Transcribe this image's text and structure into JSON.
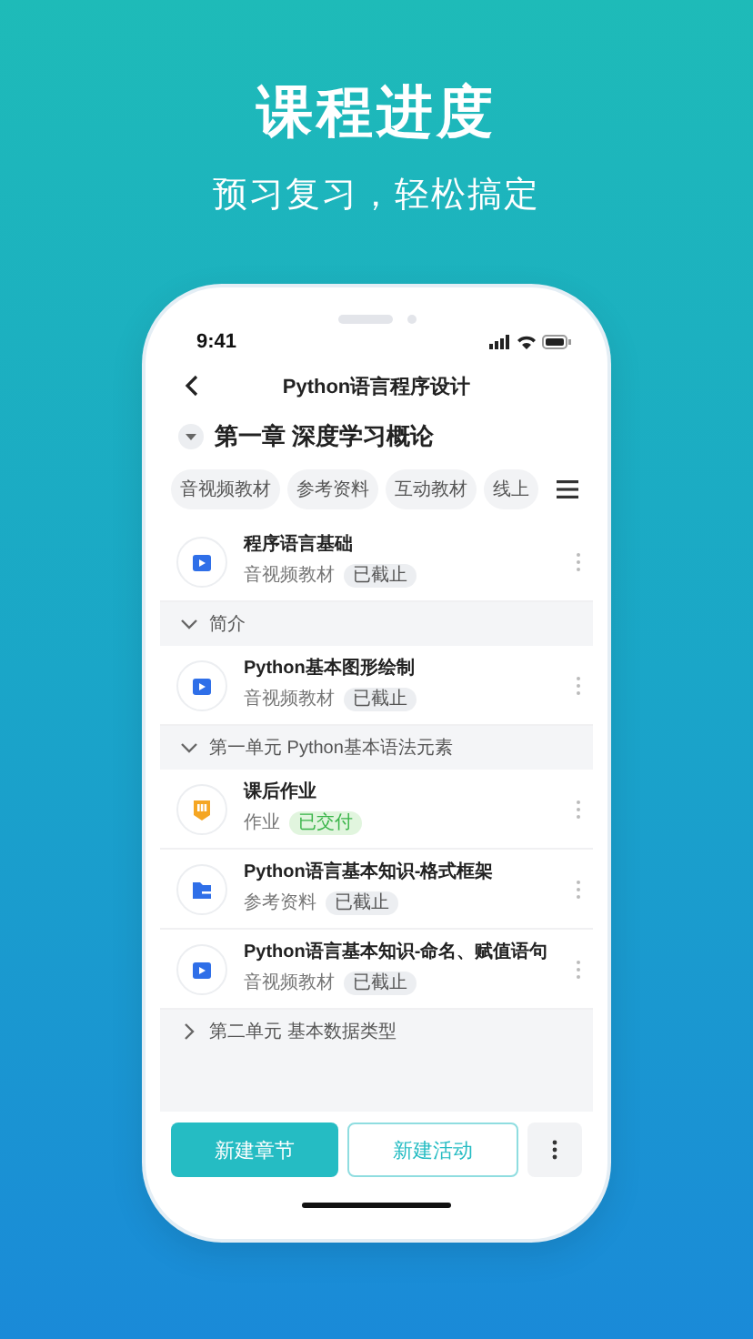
{
  "header": {
    "title": "课程进度",
    "subtitle": "预习复习，轻松搞定"
  },
  "status_bar": {
    "time": "9:41"
  },
  "nav": {
    "title": "Python语言程序设计"
  },
  "chapter": {
    "title": "第一章 深度学习概论",
    "expanded": true
  },
  "filters": [
    {
      "label": "音视频教材"
    },
    {
      "label": "参考资料"
    },
    {
      "label": "互动教材"
    },
    {
      "label": "线上"
    }
  ],
  "list": [
    {
      "kind": "video",
      "title": "程序语言基础",
      "type": "音视频教材",
      "status": {
        "text": "已截止",
        "kind": "closed"
      }
    },
    {
      "kind": "section",
      "title": "简介",
      "expanded": true
    },
    {
      "kind": "video",
      "title": "Python基本图形绘制",
      "type": "音视频教材",
      "status": {
        "text": "已截止",
        "kind": "closed"
      }
    },
    {
      "kind": "section",
      "title": "第一单元 Python基本语法元素",
      "expanded": true
    },
    {
      "kind": "homework",
      "title": "课后作业",
      "type": "作业",
      "status": {
        "text": "已交付",
        "kind": "submitted"
      }
    },
    {
      "kind": "folder",
      "title": "Python语言基本知识-格式框架",
      "type": "参考资料",
      "status": {
        "text": "已截止",
        "kind": "closed"
      }
    },
    {
      "kind": "video",
      "title": "Python语言基本知识-命名、赋值语句",
      "type": "音视频教材",
      "status": {
        "text": "已截止",
        "kind": "closed"
      }
    },
    {
      "kind": "section",
      "title": "第二单元 基本数据类型",
      "expanded": false
    }
  ],
  "buttons": [
    {
      "kind": "primary",
      "label": "新建章节"
    },
    {
      "kind": "outline",
      "label": "新建活动"
    },
    {
      "kind": "more"
    }
  ]
}
